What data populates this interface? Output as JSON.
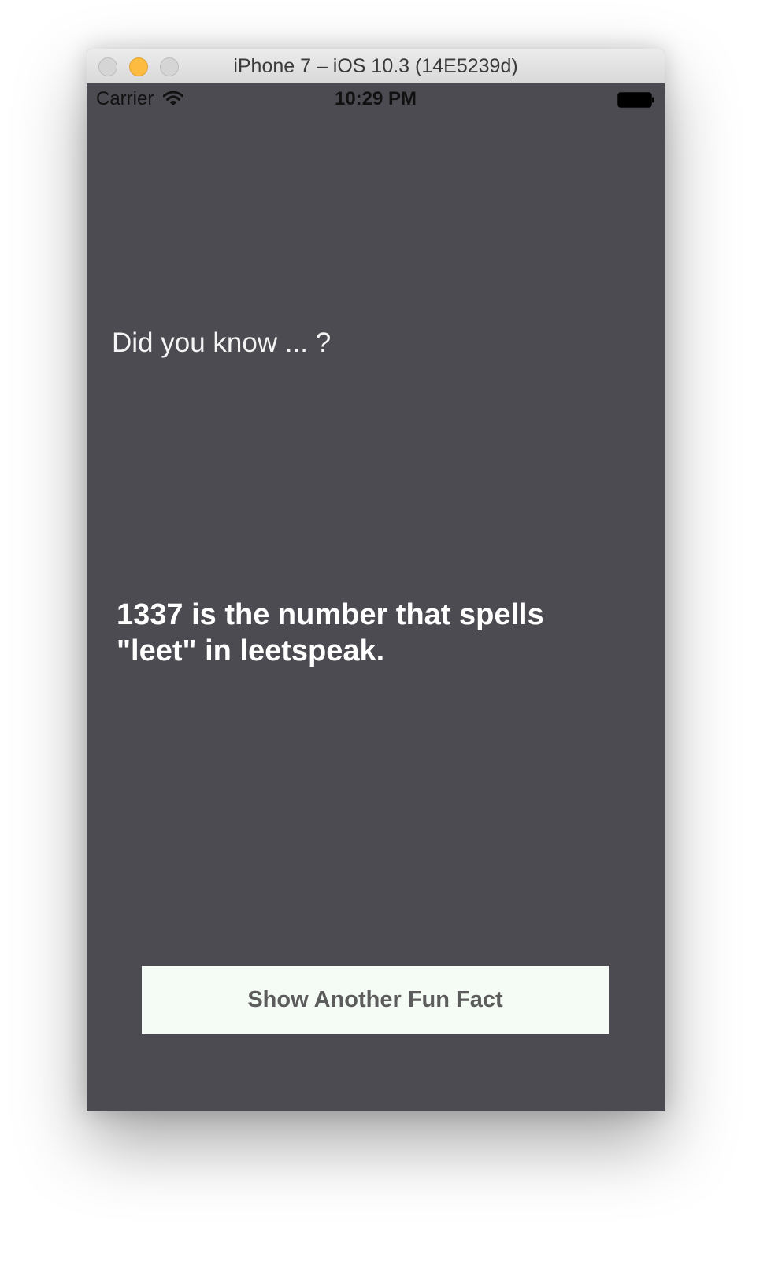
{
  "window": {
    "title": "iPhone 7 – iOS 10.3 (14E5239d)"
  },
  "statusbar": {
    "carrier": "Carrier",
    "time": "10:29 PM",
    "icons": [
      "wifi-icon",
      "battery-icon"
    ]
  },
  "main": {
    "question": "Did you know ... ?",
    "fact_lines": [
      "1337 is the number that spells",
      "\"leet\" in leetspeak."
    ],
    "button_label": "Show Another Fun Fact"
  },
  "colors": {
    "background": "#4c4b51",
    "button_background": "#f5fcf5",
    "button_text": "#5c5c5c",
    "text": "#ffffff",
    "minimize": "#fdbc40"
  }
}
